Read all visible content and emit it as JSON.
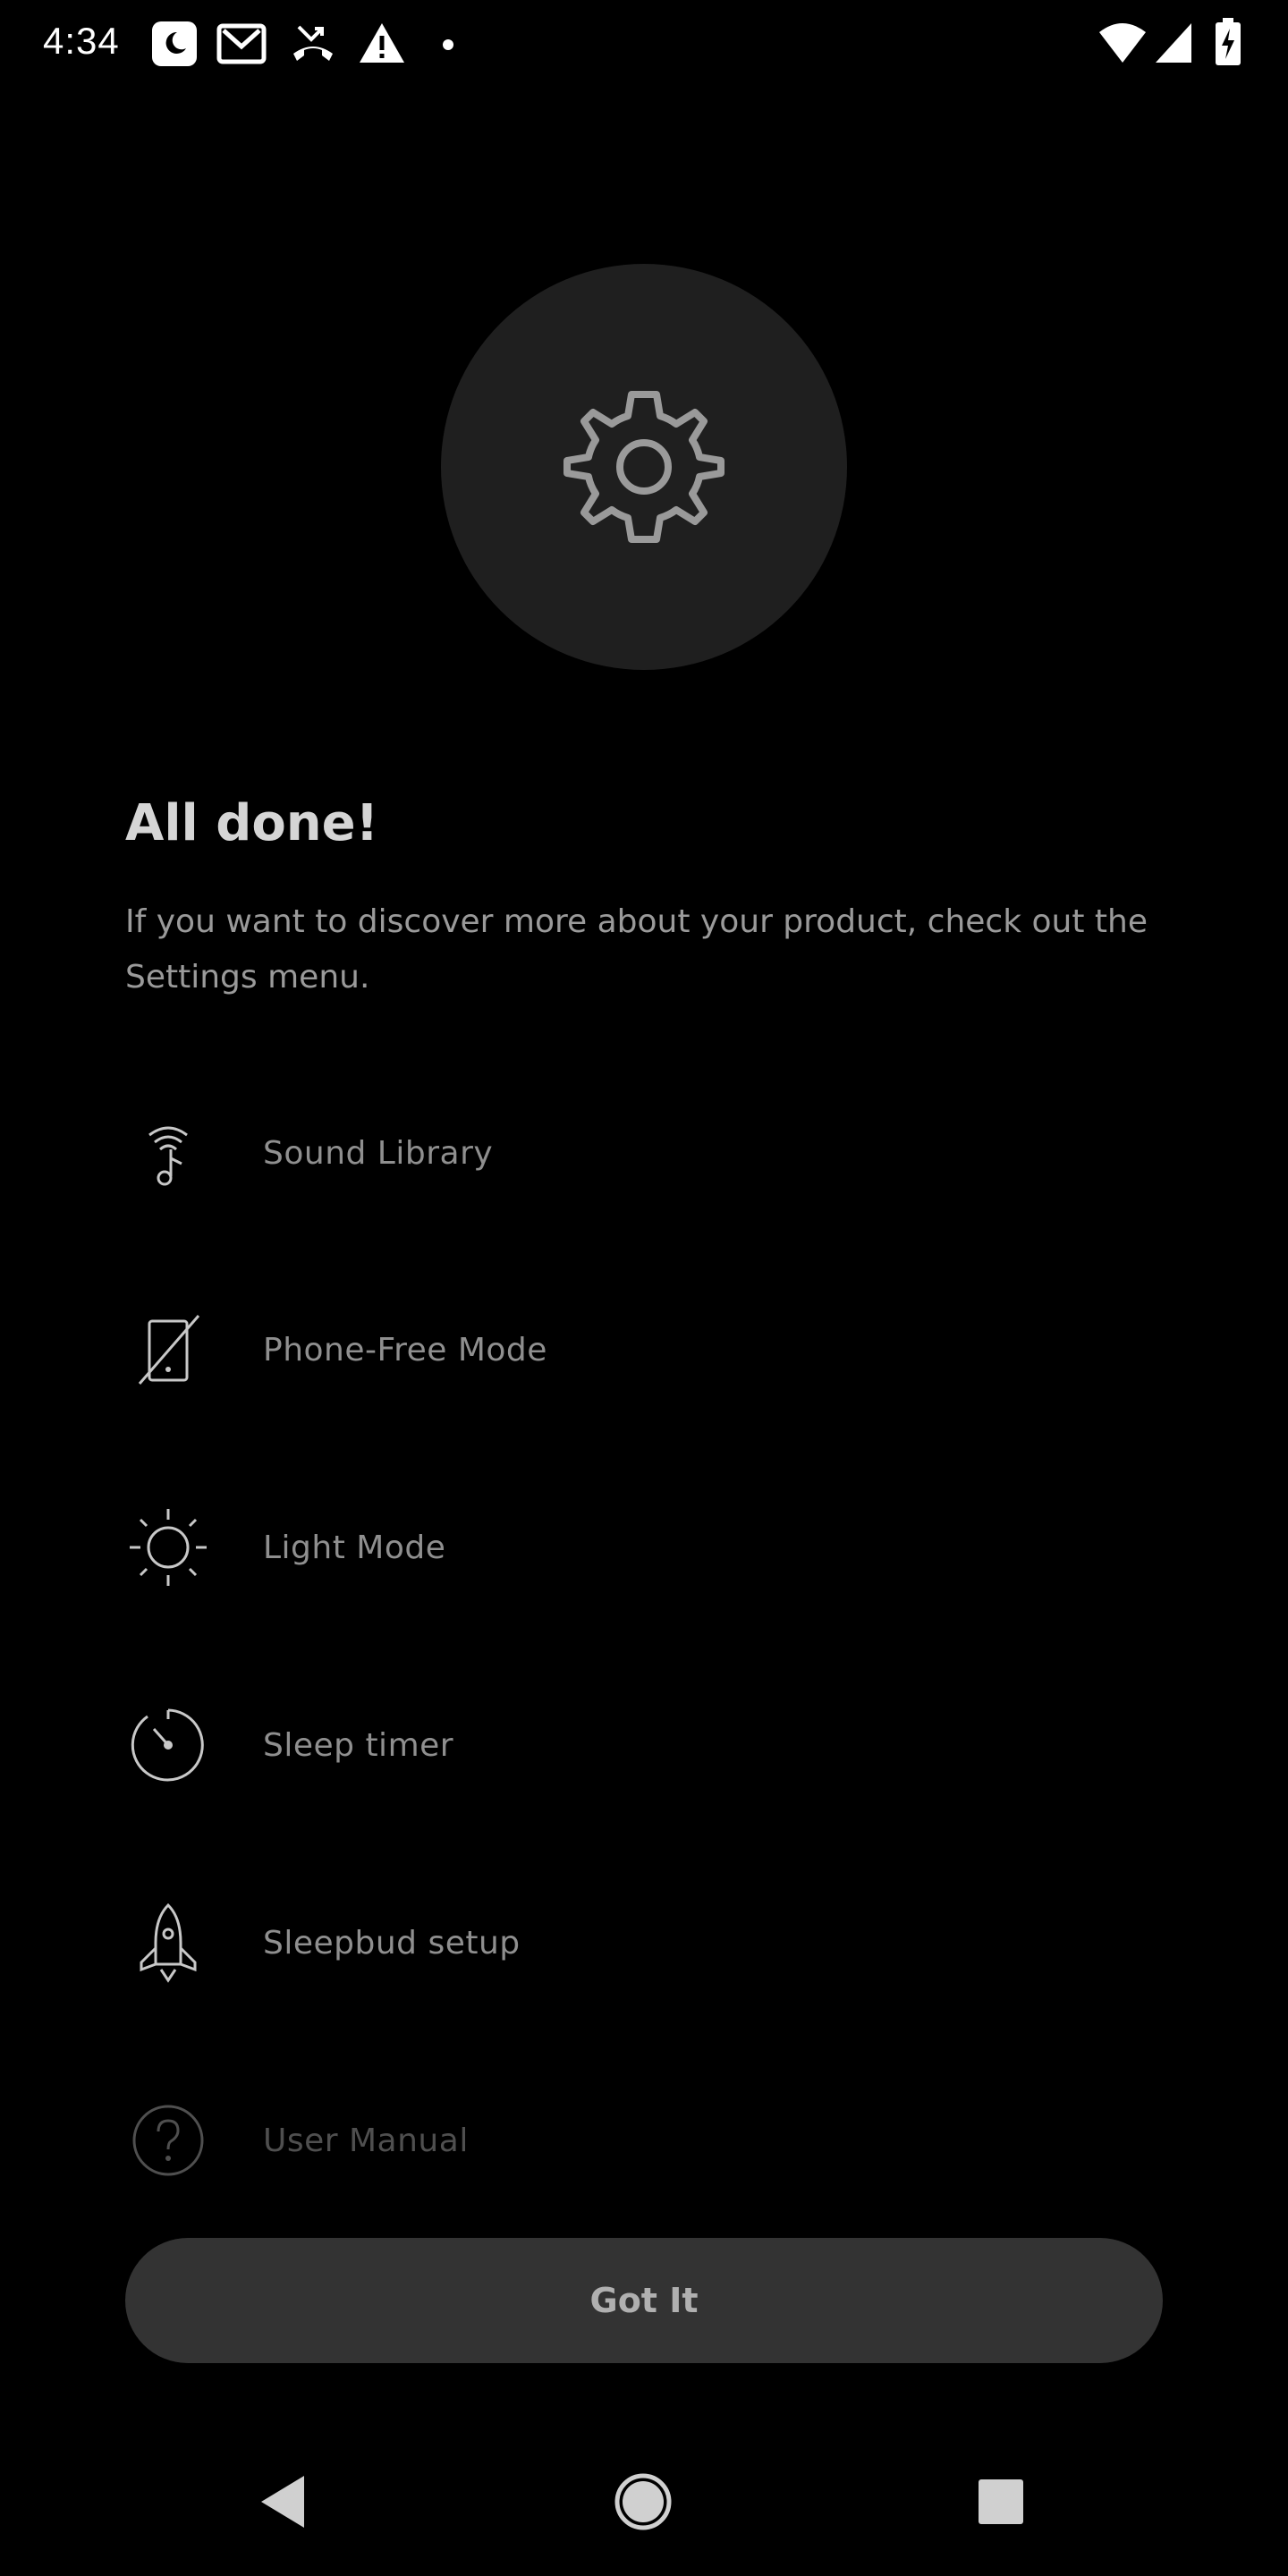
{
  "status_bar": {
    "time": "4:34",
    "icons": [
      "do-not-disturb-icon",
      "gmail-icon",
      "missed-call-icon",
      "warning-icon",
      "dot-icon",
      "wifi-icon",
      "cell-signal-icon",
      "battery-charging-icon"
    ]
  },
  "hero": {
    "icon": "gear-icon"
  },
  "title": "All done!",
  "subtitle": "If you want to discover more about your product, check out the Settings menu.",
  "menu": {
    "items": [
      {
        "label": "Sound Library",
        "icon": "sound-library-icon"
      },
      {
        "label": "Phone-Free Mode",
        "icon": "phone-free-icon"
      },
      {
        "label": "Light Mode",
        "icon": "sun-icon"
      },
      {
        "label": "Sleep timer",
        "icon": "timer-icon"
      },
      {
        "label": "Sleepbud setup",
        "icon": "rocket-icon"
      },
      {
        "label": "User Manual",
        "icon": "help-circle-icon"
      }
    ]
  },
  "button": {
    "label": "Got It"
  },
  "nav": {
    "items": [
      "back-icon",
      "home-icon",
      "recents-icon"
    ]
  },
  "colors": {
    "background": "#000000",
    "hero_circle": "#1f1f1f",
    "button": "#333333"
  }
}
